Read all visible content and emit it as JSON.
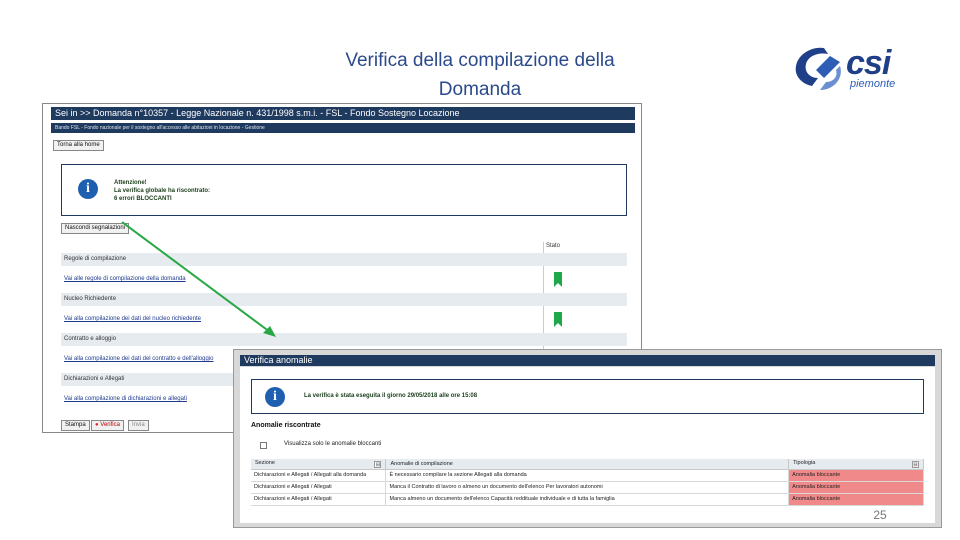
{
  "slide": {
    "title_line1": "Verifica della compilazione della",
    "title_line2": "Domanda",
    "page_number": "25"
  },
  "logo": {
    "word": "csi",
    "sub": "piemonte",
    "accent": "#1f3f88"
  },
  "form": {
    "header": "Sei in >> Domanda n°10357 - Legge Nazionale n. 431/1998 s.m.i. - FSL - Fondo Sostegno Locazione",
    "subheader": "Bando FSL - Fondo nazionale per il sostegno all'accesso alle abitazioni in locazione - Gestione",
    "home_button": "Torna alla home",
    "alert_lines": [
      "Attenzione!",
      "La verifica globale ha riscontrato:",
      "6 errori BLOCCANTI"
    ],
    "hide_button": "Nascondi segnalazioni",
    "status_header": "Stato",
    "rows": [
      {
        "type": "section",
        "text": "Regole di compilazione",
        "status": ""
      },
      {
        "type": "link",
        "text": "Vai alle regole di compilazione della domanda",
        "status": "ok"
      },
      {
        "type": "section",
        "text": "Nucleo Richiedente",
        "status": ""
      },
      {
        "type": "link",
        "text": "Vai alla compilazione dei dati del nucleo richiedente",
        "status": "ok"
      },
      {
        "type": "section",
        "text": "Contratto e alloggio",
        "status": ""
      },
      {
        "type": "link",
        "text": "Vai alla compilazione dei dati del contratto e dell'alloggio",
        "status": ""
      },
      {
        "type": "section",
        "text": "Dichiarazioni e Allegati",
        "status": ""
      },
      {
        "type": "link",
        "text": "Vai alla compilazione di dichiarazioni e allegati",
        "status": ""
      }
    ],
    "footer_buttons": {
      "print": "Stampa",
      "verify": "Verifica",
      "send": "Invia"
    }
  },
  "popup": {
    "title": "Verifica anomalie",
    "alert_text": "La verifica è stata eseguita il giorno 29/05/2018 alle ore 15:08",
    "heading": "Anomalie riscontrate",
    "checkbox_label": "Visualizza solo le anomalie bloccanti",
    "columns": [
      "Sezione",
      "Anomalie di compilazione",
      "Tipologia"
    ],
    "rows": [
      [
        "Dichiarazioni e Allegati / Allegati alla domanda",
        "È necessario compilare la sezione Allegati alla domanda",
        "Anomalia bloccante"
      ],
      [
        "Dichiarazioni e Allegati / Allegati",
        "Manca il Contratto di lavoro o almeno un documento dell'elenco Per lavoratori autonomi",
        "Anomalia bloccante"
      ],
      [
        "Dichiarazioni e Allegati / Allegati",
        "Manca almeno un documento dell'elenco Capacità reddituale individuale e di tutta la famiglia",
        "Anomalia bloccante"
      ]
    ],
    "blocking_color": "#f08a8a"
  },
  "colors": {
    "title_blue": "#2b4a8a",
    "header_navy": "#1f3a5f",
    "ok_green": "#1fa84a",
    "arrow_green": "#27a844"
  }
}
